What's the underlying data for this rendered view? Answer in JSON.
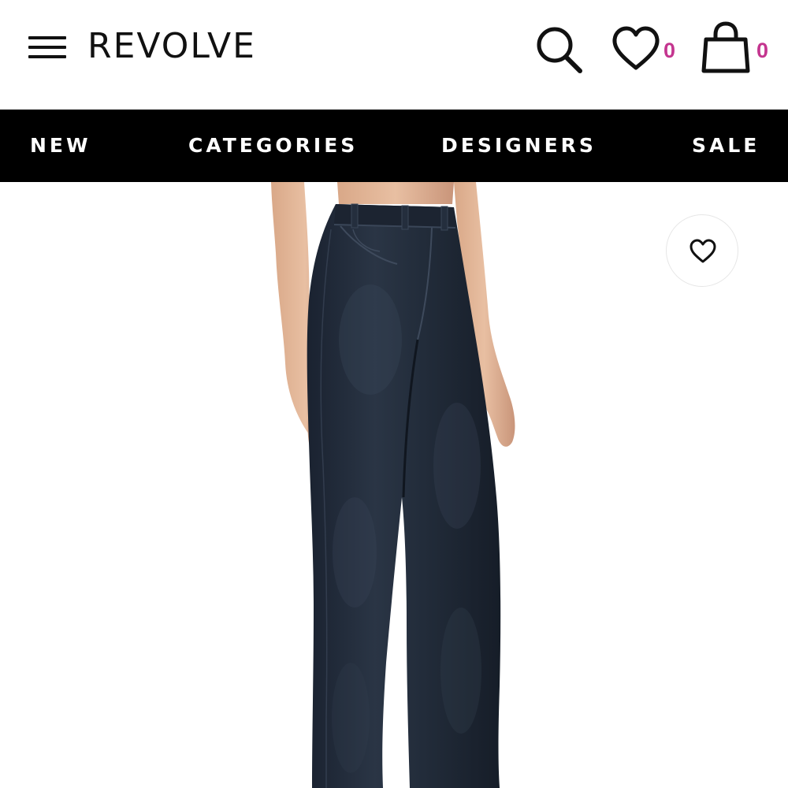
{
  "header": {
    "logo": "REVOLVE",
    "wishlist_count": "0",
    "bag_count": "0",
    "count_color": "#c4358f"
  },
  "nav": {
    "items": [
      "NEW",
      "CATEGORIES",
      "DESIGNERS",
      "SALE"
    ]
  },
  "icons": {
    "menu": "hamburger-menu-icon",
    "search": "search-icon",
    "wishlist": "heart-icon",
    "bag": "shopping-bag-icon",
    "favorite": "heart-icon"
  },
  "product": {
    "image": "dark-wash-high-rise-jeans"
  }
}
